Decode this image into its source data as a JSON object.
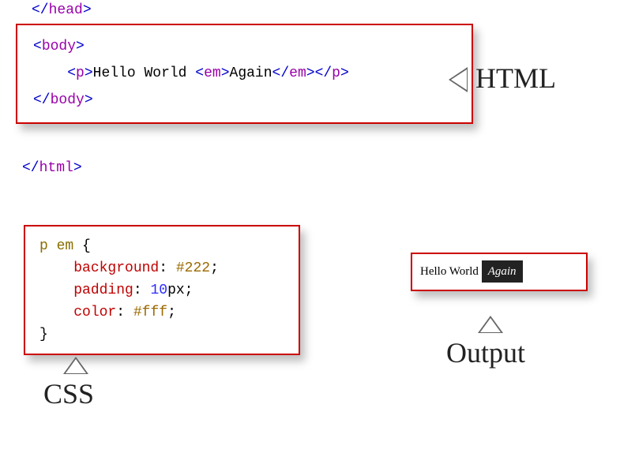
{
  "labels": {
    "html": "HTML",
    "css": "CSS",
    "output": "Output"
  },
  "html_code": {
    "head_close": "</head>",
    "body_open": "<body>",
    "p_line_prefix": "<p>",
    "p_text1": "Hello World ",
    "em_open": "<em>",
    "em_text": "Again",
    "em_close": "</em>",
    "p_close": "</p>",
    "body_close": "</body>",
    "html_close": "</html>"
  },
  "css_code": {
    "selector": "p em",
    "open_brace": " {",
    "prop1": "background",
    "val1": "#222",
    "prop2": "padding",
    "val2_num": "10",
    "val2_unit": "px",
    "prop3": "color",
    "val3": "#fff",
    "close_brace": "}"
  },
  "output": {
    "text1": "Hello World ",
    "em_text": "Again"
  }
}
